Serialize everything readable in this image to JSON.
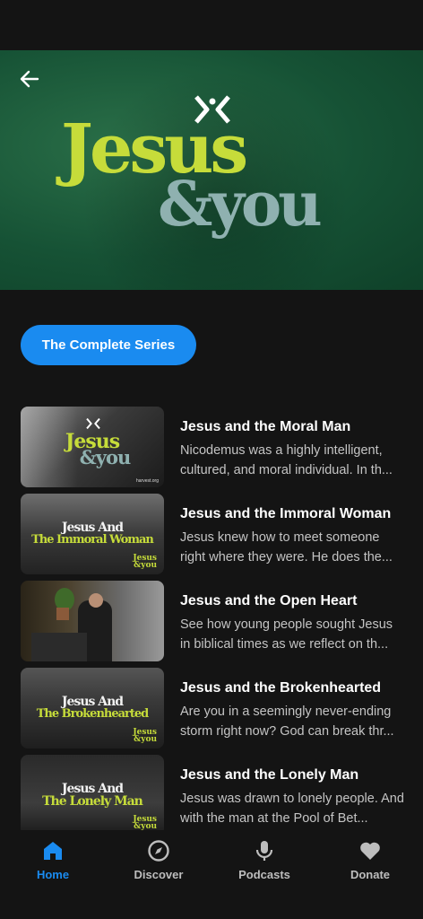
{
  "hero": {
    "title_line1": "Jesus",
    "title_line2": "&you"
  },
  "series_button": {
    "label": "The Complete Series"
  },
  "episodes": [
    {
      "title": "Jesus and the Moral Man",
      "description": "Nicodemus was a highly intelligent, cultured, and moral individual. In th...",
      "thumb_line1": "Jesus",
      "thumb_line2": "&you",
      "thumb_small": "harvest.org"
    },
    {
      "title": "Jesus and the Immoral Woman",
      "description": "Jesus knew how to meet someone right where they were. He does the...",
      "thumb_line1": "Jesus And",
      "thumb_line2": "The Immoral Woman",
      "thumb_corner": "Jesus\n&you"
    },
    {
      "title": "Jesus and the Open Heart",
      "description": "See how young people sought Jesus in biblical times as we reflect on th..."
    },
    {
      "title": "Jesus and the Brokenhearted",
      "description": "Are you in a seemingly never-ending storm right now? God can break thr...",
      "thumb_line1": "Jesus And",
      "thumb_line2": "The Brokenhearted",
      "thumb_corner": "Jesus\n&you"
    },
    {
      "title": "Jesus and the Lonely Man",
      "description": "Jesus was drawn to lonely people. And with the man at the Pool of Bet...",
      "thumb_line1": "Jesus And",
      "thumb_line2": "The Lonely Man",
      "thumb_corner": "Jesus\n&you"
    }
  ],
  "tabs": [
    {
      "label": "Home",
      "icon": "home-icon",
      "active": true
    },
    {
      "label": "Discover",
      "icon": "compass-icon",
      "active": false
    },
    {
      "label": "Podcasts",
      "icon": "microphone-icon",
      "active": false
    },
    {
      "label": "Donate",
      "icon": "heart-icon",
      "active": false
    }
  ],
  "colors": {
    "accent": "#1a8bf0",
    "brand_green": "#165235",
    "title_yellow": "#c6dc3a",
    "title_teal": "#8fb1b0",
    "background": "#141414"
  }
}
